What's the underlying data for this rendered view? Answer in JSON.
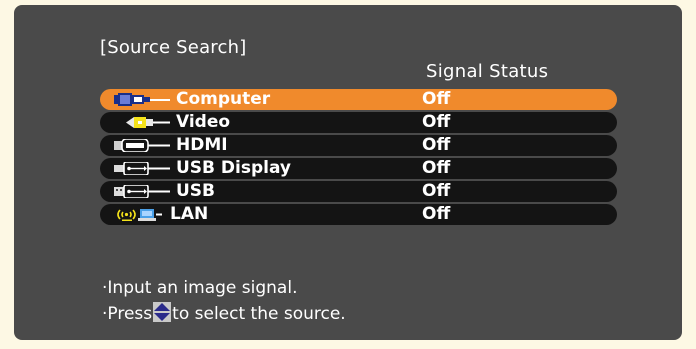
{
  "dialog": {
    "title": "[Source Search]",
    "status_header": "Signal Status"
  },
  "sources": [
    {
      "label": "Computer",
      "status": "Off",
      "icon": "computer-vga-icon",
      "selected": true
    },
    {
      "label": "Video",
      "status": "Off",
      "icon": "video-rca-icon",
      "selected": false
    },
    {
      "label": "HDMI",
      "status": "Off",
      "icon": "hdmi-icon",
      "selected": false
    },
    {
      "label": "USB Display",
      "status": "Off",
      "icon": "usb-display-icon",
      "selected": false
    },
    {
      "label": "USB",
      "status": "Off",
      "icon": "usb-icon",
      "selected": false
    },
    {
      "label": "LAN",
      "status": "Off",
      "icon": "lan-wireless-icon",
      "selected": false
    }
  ],
  "help": {
    "line1": "·Input an image signal.",
    "line2_prefix": "·Press",
    "line2_suffix": "to select the source.",
    "arrow_icon": "up-down-arrow-icon"
  },
  "colors": {
    "background": "#fdf8e4",
    "panel": "#4a4a4a",
    "row": "#141414",
    "selected": "#f08a2c",
    "text": "#ffffff"
  }
}
